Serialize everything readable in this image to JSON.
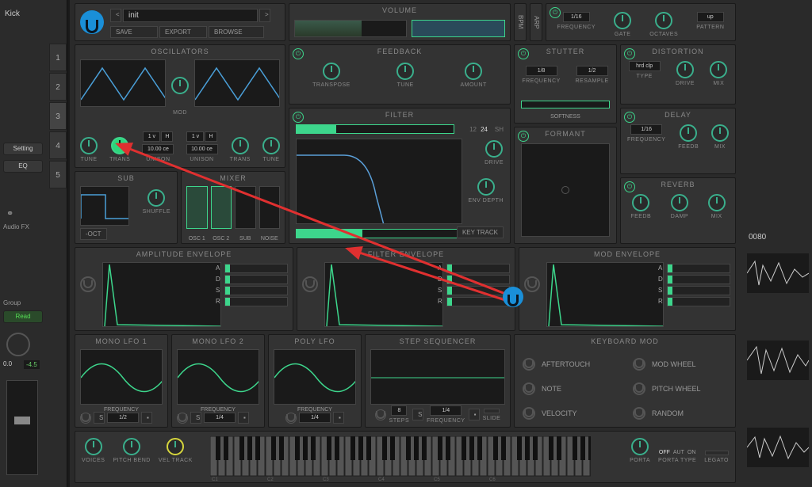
{
  "daw": {
    "track_name": "Kick",
    "tracks": [
      "1",
      "2",
      "3",
      "4",
      "5"
    ],
    "selected_track": 2,
    "setting_btn": "Setting",
    "eq_btn": "EQ",
    "audio_fx": "Audio FX",
    "group": "Group",
    "read": "Read",
    "pan": "0.0",
    "db": "-4.5",
    "timecode": "0080"
  },
  "header": {
    "preset": "init",
    "save": "SAVE",
    "export": "EXPORT",
    "browse": "BROWSE",
    "volume": "VOLUME",
    "bpm": "BPM",
    "arp": "ARP",
    "arp_rate": "1/16",
    "arp_knobs": {
      "frequency": "FREQUENCY",
      "gate": "GATE",
      "octaves": "OCTAVES",
      "pattern": "PATTERN"
    },
    "arp_pattern": "up"
  },
  "osc": {
    "title": "OSCILLATORS",
    "mod": "MOD",
    "unison_val": "10.00 ce",
    "voices": "1 v",
    "h": "H",
    "knobs": {
      "tune": "TUNE",
      "trans": "TRANS",
      "unison": "UNISON"
    }
  },
  "sub": {
    "title": "SUB",
    "shuffle": "SHUFFLE",
    "oct": "-OCT"
  },
  "mixer": {
    "title": "MIXER",
    "labels": [
      "OSC 1",
      "OSC 2",
      "SUB",
      "NOISE"
    ]
  },
  "feedback": {
    "title": "FEEDBACK",
    "knobs": {
      "transpose": "TRANSPOSE",
      "tune": "TUNE",
      "amount": "AMOUNT"
    }
  },
  "filter": {
    "title": "FILTER",
    "v12": "12",
    "v24": "24",
    "sh": "SH",
    "drive": "DRIVE",
    "env_depth": "ENV DEPTH",
    "key_track": "KEY TRACK"
  },
  "stutter": {
    "title": "STUTTER",
    "r1": "1/8",
    "r2": "1/2",
    "frequency": "FREQUENCY",
    "resample": "RESAMPLE",
    "softness": "SOFTNESS"
  },
  "formant": {
    "title": "FORMANT"
  },
  "distortion": {
    "title": "DISTORTION",
    "type_val": "hrd clp",
    "type": "TYPE",
    "drive": "DRIVE",
    "mix": "MIX"
  },
  "delay": {
    "title": "DELAY",
    "rate": "1/16",
    "frequency": "FREQUENCY",
    "feedb": "FEEDB",
    "mix": "MIX"
  },
  "reverb": {
    "title": "REVERB",
    "feedb": "FEEDB",
    "damp": "DAMP",
    "mix": "MIX"
  },
  "env": {
    "amp": "AMPLITUDE ENVELOPE",
    "filter": "FILTER ENVELOPE",
    "mod": "MOD ENVELOPE",
    "a": "A",
    "d": "D",
    "s": "S",
    "r": "R"
  },
  "lfo": {
    "mono1": "MONO LFO 1",
    "mono2": "MONO LFO 2",
    "poly": "POLY LFO",
    "frequency": "FREQUENCY",
    "r1": "1/2",
    "r2": "1/4",
    "s": "S"
  },
  "seq": {
    "title": "STEP SEQUENCER",
    "steps_label": "STEPS",
    "steps": "8",
    "freq_label": "FREQUENCY",
    "rate": "1/4",
    "slide": "SLIDE",
    "s": "S"
  },
  "keymod": {
    "title": "KEYBOARD MOD",
    "aftertouch": "AFTERTOUCH",
    "note": "NOTE",
    "velocity": "VELOCITY",
    "modwheel": "MOD WHEEL",
    "pitchwheel": "PITCH WHEEL",
    "random": "RANDOM"
  },
  "footer": {
    "voices": "VOICES",
    "pitch_bend": "PITCH BEND",
    "vel_track": "VEL TRACK",
    "porta": "PORTA",
    "porta_type": "PORTA TYPE",
    "legato": "LEGATO",
    "off": "OFF",
    "aut": "AUT",
    "on": "ON",
    "octaves": [
      "C1",
      "C2",
      "C3",
      "C4",
      "C5",
      "C6"
    ]
  }
}
